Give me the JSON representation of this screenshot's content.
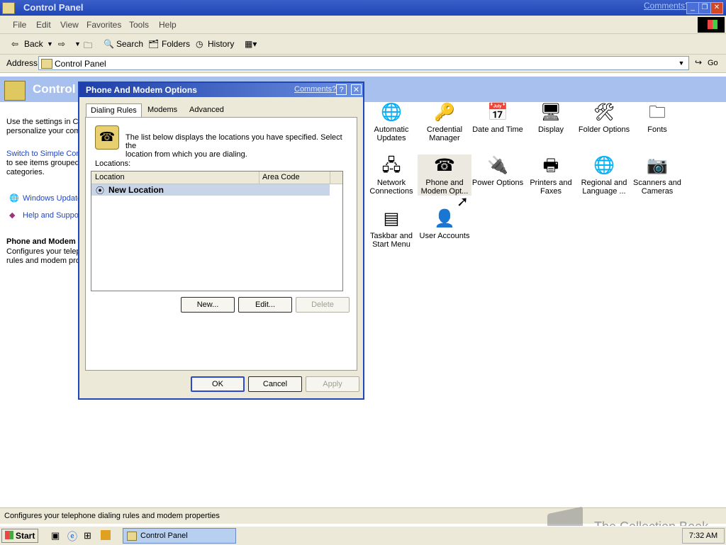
{
  "window": {
    "title": "Control Panel",
    "comments_link": "Comments?"
  },
  "menu": [
    "File",
    "Edit",
    "View",
    "Favorites",
    "Tools",
    "Help"
  ],
  "toolbar": {
    "back": "Back",
    "search": "Search",
    "folders": "Folders",
    "history": "History"
  },
  "address": {
    "label": "Address",
    "value": "Control Panel",
    "go": "Go"
  },
  "left_panel": {
    "header": "Control",
    "intro": [
      "Use the settings in Co",
      "personalize your com"
    ],
    "switch_link": "Switch to Simple Conl",
    "switch_text": [
      "to see items grouped",
      "categories."
    ],
    "see_also": [
      "Windows Update",
      "Help and Suppor"
    ],
    "selected_title": "Phone and Modem",
    "selected_desc": [
      "Configures your telep",
      "rules and modem pro"
    ]
  },
  "items": [
    {
      "label": [
        "Automatic",
        "Updates"
      ],
      "icon": "globe-icon"
    },
    {
      "label": [
        "Credential",
        "Manager"
      ],
      "icon": "keys-icon"
    },
    {
      "label": [
        "Date and Time"
      ],
      "icon": "calendar-clock-icon"
    },
    {
      "label": [
        "Display"
      ],
      "icon": "monitor-icon"
    },
    {
      "label": [
        "Folder Options"
      ],
      "icon": "folder-tools-icon"
    },
    {
      "label": [
        "Fonts"
      ],
      "icon": "fonts-folder-icon"
    },
    {
      "label": [
        "Network",
        "Connections"
      ],
      "icon": "network-icon"
    },
    {
      "label": [
        "Phone and",
        "Modem Opt..."
      ],
      "icon": "phone-icon",
      "selected": true
    },
    {
      "label": [
        "Power Options"
      ],
      "icon": "power-plug-icon"
    },
    {
      "label": [
        "Printers and",
        "Faxes"
      ],
      "icon": "printer-icon"
    },
    {
      "label": [
        "Regional and",
        "Language ..."
      ],
      "icon": "globe-icon"
    },
    {
      "label": [
        "Scanners and",
        "Cameras"
      ],
      "icon": "camera-icon"
    },
    {
      "label": [
        "Taskbar and",
        "Start Menu"
      ],
      "icon": "taskbar-icon"
    },
    {
      "label": [
        "User Accounts"
      ],
      "icon": "user-icon"
    }
  ],
  "dialog": {
    "title": "Phone And Modem Options",
    "comments": "Comments?",
    "help": "?",
    "close": "✕",
    "tabs": [
      "Dialing Rules",
      "Modems",
      "Advanced"
    ],
    "description": [
      "The list below displays the locations you have specified. Select the",
      "location from which you are dialing."
    ],
    "locations_label": "Locations:",
    "columns": [
      "Location",
      "Area Code"
    ],
    "rows": [
      {
        "location": "New Location",
        "area_code": ""
      }
    ],
    "buttons": {
      "new": "New...",
      "edit": "Edit...",
      "delete": "Delete"
    },
    "footer": {
      "ok": "OK",
      "cancel": "Cancel",
      "apply": "Apply"
    }
  },
  "status": "Configures your telephone dialing rules and modem properties",
  "taskbar": {
    "start": "Start",
    "task": "Control Panel",
    "clock": "7:32 AM"
  },
  "watermark": "The Collection Book"
}
